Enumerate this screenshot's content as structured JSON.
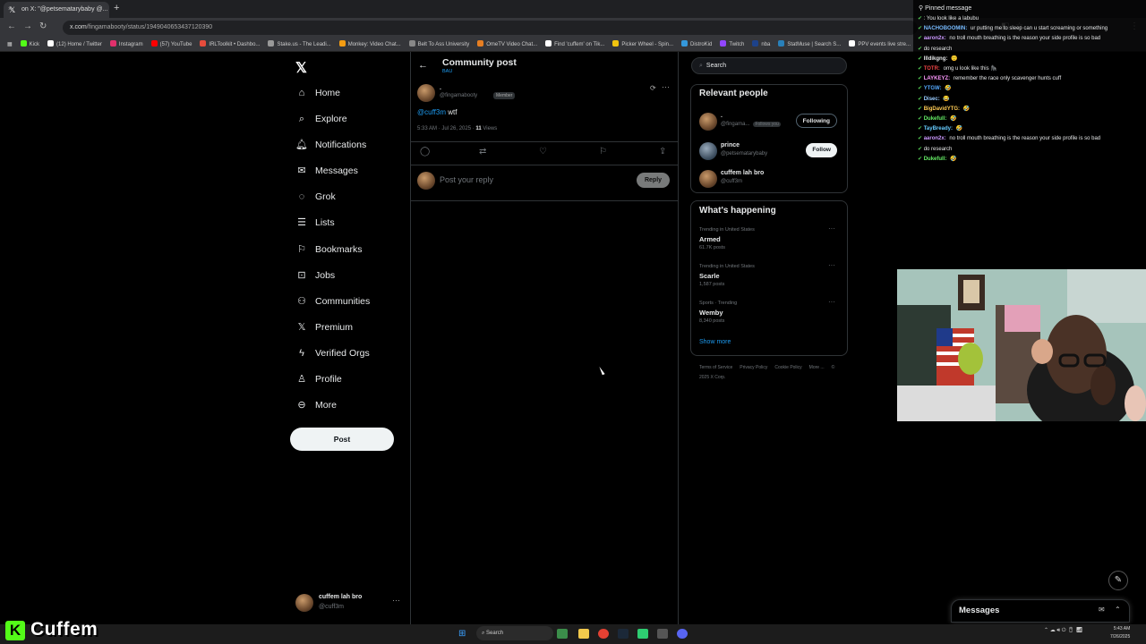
{
  "browser": {
    "tab_title": "on X: \"@petsematarybaby @...",
    "url_host": "x.com",
    "url_path": "/fingamabooty/status/1949040653437120390",
    "bookmarks": [
      "Kick",
      "(12) Home / Twitter",
      "Instagram",
      "(57) YouTube",
      "IRLToolkit • Dashbo...",
      "Stake.us - The Leadi...",
      "Monkey: Video Chat...",
      "Belt To Ass University",
      "OmeTV Video Chat...",
      "Find 'cuffem' on Tik...",
      "Picker Wheel - Spin...",
      "DistroKid",
      "Twitch",
      "nba",
      "StatMuse | Search S...",
      "PPV events live stre..."
    ]
  },
  "sidebar": {
    "items": [
      {
        "label": "Home",
        "icon": "home-icon",
        "glyph": "⌂"
      },
      {
        "label": "Explore",
        "icon": "search-icon",
        "glyph": "⌕"
      },
      {
        "label": "Notifications",
        "icon": "bell-icon",
        "glyph": "🔔︎"
      },
      {
        "label": "Messages",
        "icon": "envelope-icon",
        "glyph": "✉"
      },
      {
        "label": "Grok",
        "icon": "grok-icon",
        "glyph": "◌"
      },
      {
        "label": "Lists",
        "icon": "list-icon",
        "glyph": "☰"
      },
      {
        "label": "Bookmarks",
        "icon": "bookmark-icon",
        "glyph": "⚐"
      },
      {
        "label": "Jobs",
        "icon": "briefcase-icon",
        "glyph": "⊡"
      },
      {
        "label": "Communities",
        "icon": "people-icon",
        "glyph": "⚇"
      },
      {
        "label": "Premium",
        "icon": "x-icon",
        "glyph": "𝕏"
      },
      {
        "label": "Verified Orgs",
        "icon": "bolt-icon",
        "glyph": "ϟ"
      },
      {
        "label": "Profile",
        "icon": "person-icon",
        "glyph": "♙"
      },
      {
        "label": "More",
        "icon": "more-circle-icon",
        "glyph": "⊖"
      }
    ],
    "post_label": "Post",
    "account": {
      "name": "cuffem lah bro",
      "handle": "@cuff3m"
    }
  },
  "post_view": {
    "title": "Community post",
    "subtitle": "BAU",
    "author_name": ".",
    "author_handle": "@fingamabooty",
    "author_badge": "Member",
    "mention": "@cuff3m",
    "text": "wtf",
    "time": "5:33 AM · Jul 26, 2025 · ",
    "views_count": "11",
    "views_label": "Views",
    "reply_placeholder": "Post your reply",
    "reply_label": "Reply"
  },
  "right": {
    "search_placeholder": "Search",
    "relevant_title": "Relevant people",
    "people": [
      {
        "name": ".",
        "handle": "@fingama...",
        "extra": "Follows you",
        "button": "Following",
        "style": "following"
      },
      {
        "name": "prince",
        "handle": "@petsematarybaby",
        "extra": "",
        "button": "Follow",
        "style": "follow"
      },
      {
        "name": "cuffem lah bro",
        "handle": "@cuff3m",
        "extra": "",
        "button": "",
        "style": "none"
      }
    ],
    "happening_title": "What's happening",
    "trends": [
      {
        "context": "Trending in United States",
        "title": "Armed",
        "posts": "61.7K posts"
      },
      {
        "context": "Trending in United States",
        "title": "Scarle",
        "posts": "1,587 posts"
      },
      {
        "context": "Sports · Trending",
        "title": "Wemby",
        "posts": "8,340 posts"
      }
    ],
    "show_more": "Show more",
    "footer": [
      "Terms of Service",
      "Privacy Policy",
      "Cookie Policy",
      "More ...",
      "© 2025 X Corp."
    ]
  },
  "chat": {
    "pinned": "Pinned message",
    "lines": [
      {
        "user": "",
        "text": ": You look like a labubu",
        "color": "#e66"
      },
      {
        "user": "NACHOBOOMIN:",
        "text": " ur putting me to sleep can u start screaming or something",
        "color": "#7bf"
      },
      {
        "user": "aaron2x:",
        "text": " no troll mouth breathing is the reason your side profile is so bad",
        "color": "#c9f"
      },
      {
        "user": "",
        "text": "do research",
        "color": "#e7e9ea"
      },
      {
        "user": "Illdikgng:",
        "text": " 🙂",
        "color": "#e7e9ea"
      },
      {
        "user": "TOTR:",
        "text": " omg u look like this 🦍",
        "color": "#e44"
      },
      {
        "user": "LAYKEYZ:",
        "text": " remember the race only scavenger hunts cuff",
        "color": "#f9f"
      },
      {
        "user": "YTGW:",
        "text": " 🤣",
        "color": "#5af"
      },
      {
        "user": "Disec:",
        "text": " 😂",
        "color": "#9cf"
      },
      {
        "user": "BigDavidYTG:",
        "text": " 🤣",
        "color": "#fc5"
      },
      {
        "user": "Dukefull:",
        "text": " 🤣",
        "color": "#6e6"
      },
      {
        "user": "TayBready:",
        "text": " 🤣",
        "color": "#6cf"
      },
      {
        "user": "aaron2x:",
        "text": " no troll mouth breathing is the reason your side profile is so bad",
        "color": "#c9f"
      },
      {
        "user": "",
        "text": "do research",
        "color": "#e7e9ea"
      },
      {
        "user": "Dukefull:",
        "text": " 🤣",
        "color": "#6e6"
      }
    ]
  },
  "messages_bar": {
    "title": "Messages"
  },
  "stream": {
    "brand": "Cuffem"
  },
  "taskbar": {
    "search": "Search",
    "time": "5:43 AM",
    "date": "7/26/2025"
  }
}
